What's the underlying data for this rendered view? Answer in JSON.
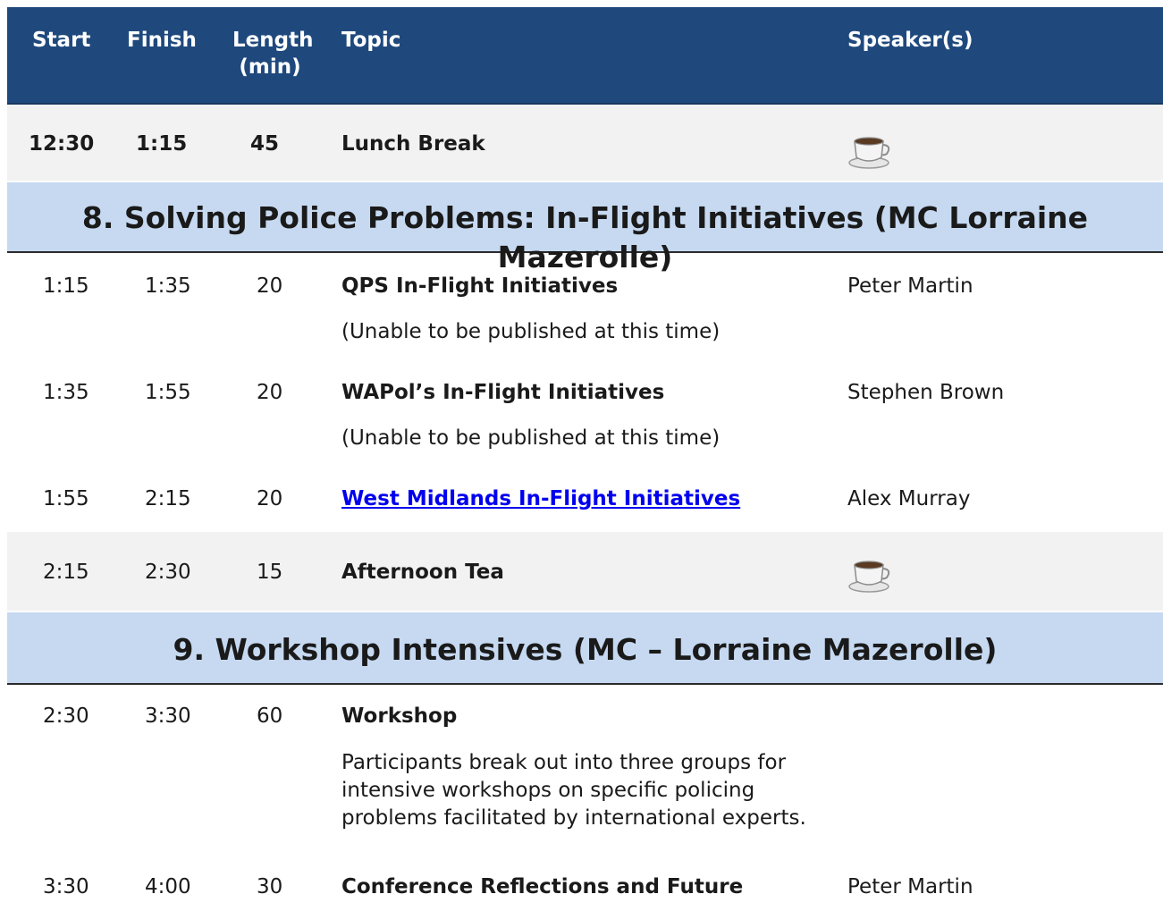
{
  "header": {
    "start": "Start",
    "finish": "Finish",
    "length_line1": "Length",
    "length_line2": "(min)",
    "topic": "Topic",
    "speakers": "Speaker(s)"
  },
  "lunch": {
    "start": "12:30",
    "finish": "1:15",
    "length": "45",
    "topic": "Lunch Break",
    "icon": "coffee-cup-icon"
  },
  "section8": {
    "title": "8. Solving Police Problems: In-Flight Initiatives (MC Lorraine Mazerolle)"
  },
  "rows8": [
    {
      "start": "1:15",
      "finish": "1:35",
      "length": "20",
      "topic": "QPS In-Flight Initiatives",
      "note": "(Unable to be published at this time)",
      "speaker": "Peter Martin"
    },
    {
      "start": "1:35",
      "finish": "1:55",
      "length": "20",
      "topic": "WAPol’s In-Flight Initiatives",
      "note": "(Unable to be published at this time)",
      "speaker": "Stephen Brown"
    },
    {
      "start": "1:55",
      "finish": "2:15",
      "length": "20",
      "topic": "West Midlands In-Flight Initiatives",
      "speaker": "Alex Murray"
    }
  ],
  "tea": {
    "start": "2:15",
    "finish": "2:30",
    "length": "15",
    "topic": "Afternoon Tea",
    "icon": "coffee-cup-icon"
  },
  "section9": {
    "title": "9. Workshop Intensives (MC – Lorraine Mazerolle)"
  },
  "rows9": [
    {
      "start": "2:30",
      "finish": "3:30",
      "length": "60",
      "topic": "Workshop",
      "desc1": "Participants break out into three groups for",
      "desc2": "intensive workshops on specific policing",
      "desc3": "problems facilitated by international experts."
    },
    {
      "start": "3:30",
      "finish": "4:00",
      "length": "30",
      "topic": "Conference Reflections and Future",
      "speaker": "Peter Martin"
    }
  ],
  "colors": {
    "header_bg": "#1f497d",
    "section_bg": "#c6d9f1",
    "band_bg": "#f2f2f2",
    "link": "#0000ee"
  }
}
